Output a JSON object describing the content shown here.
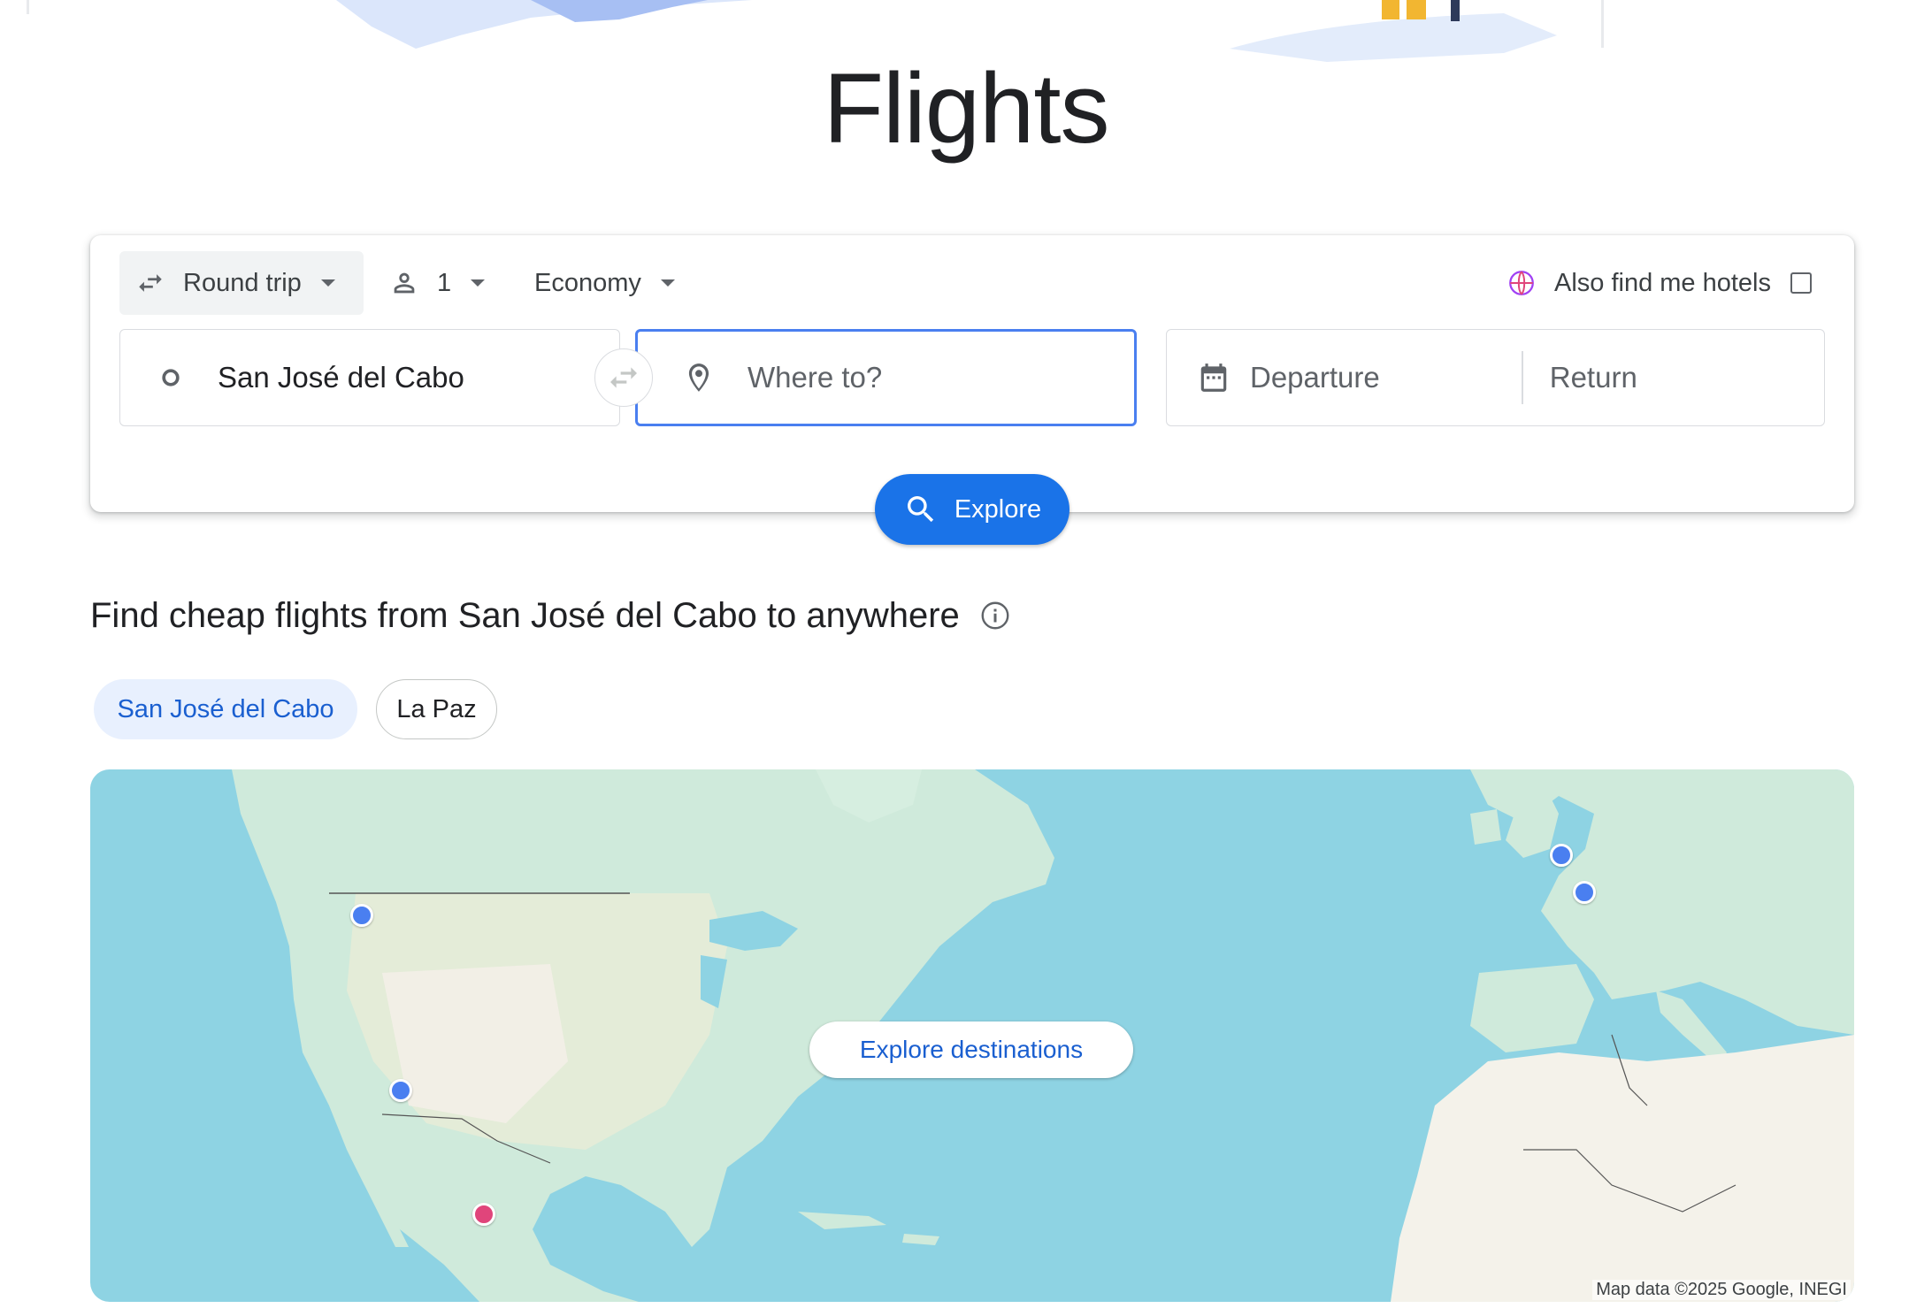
{
  "page": {
    "title": "Flights"
  },
  "search": {
    "trip_type": "Round trip",
    "passengers": "1",
    "cabin_class": "Economy",
    "hotels_label": "Also find me hotels",
    "hotels_checked": false,
    "origin_value": "San José del Cabo",
    "destination_placeholder": "Where to?",
    "departure_placeholder": "Departure",
    "return_placeholder": "Return",
    "explore_label": "Explore"
  },
  "section": {
    "title": "Find cheap flights from San José del Cabo to anywhere",
    "chips": [
      {
        "label": "San José del Cabo",
        "selected": true
      },
      {
        "label": "La Paz",
        "selected": false
      }
    ]
  },
  "map": {
    "explore_destinations_label": "Explore destinations",
    "credit": "Map data ©2025 Google, INEGI",
    "colors": {
      "water": "#8ed3e3",
      "land": "#cfeadb",
      "marker": "#4a7ff0",
      "origin_marker": "#e0457b"
    }
  },
  "icons": [
    "swap-arrows-icon",
    "person-icon",
    "globe-hotel-icon",
    "origin-circle-icon",
    "location-pin-icon",
    "calendar-icon",
    "search-icon",
    "info-icon"
  ],
  "colors": {
    "accent": "#1a73e8",
    "chip_bg": "#e8f0fe"
  }
}
